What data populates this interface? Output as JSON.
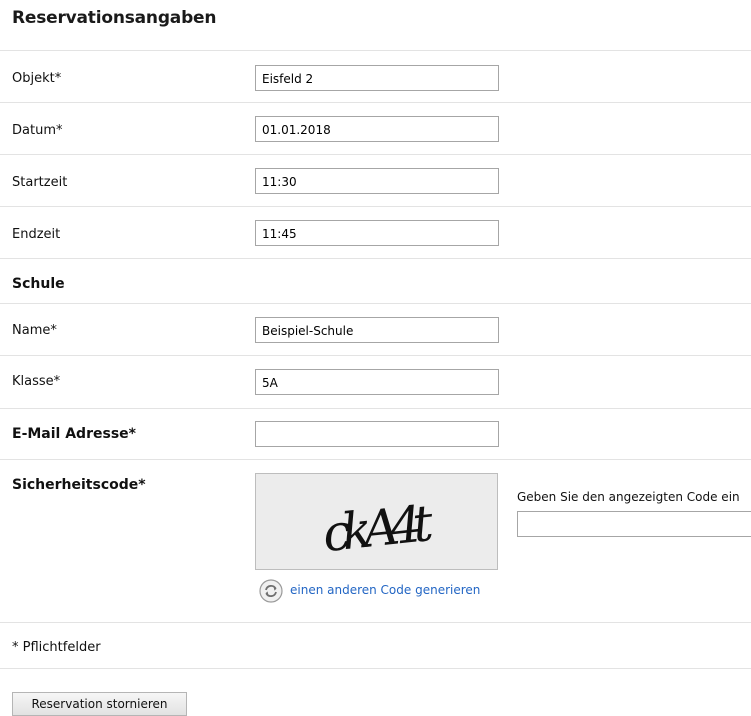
{
  "header": {
    "title": "Reservationsangaben"
  },
  "reservation": {
    "objekt_label": "Objekt*",
    "objekt_value": "Eisfeld 2",
    "datum_label": "Datum*",
    "datum_value": "01.01.2018",
    "startzeit_label": "Startzeit",
    "startzeit_value": "11:30",
    "endzeit_label": "Endzeit",
    "endzeit_value": "11:45"
  },
  "school": {
    "section_label": "Schule",
    "name_label": "Name*",
    "name_value": "Beispiel-Schule",
    "klasse_label": "Klasse*",
    "klasse_value": "5A"
  },
  "email": {
    "label": "E-Mail Adresse*",
    "value": ""
  },
  "security": {
    "label": "Sicherheitscode*",
    "captcha_text": "ckA4t",
    "refresh_icon": "refresh-icon",
    "refresh_link": "einen anderen Code generieren",
    "code_hint": "Geben Sie den angezeigten Code ein",
    "code_value": ""
  },
  "footer": {
    "required_note": "* Pflichtfelder",
    "cancel_button": "Reservation stornieren"
  },
  "colors": {
    "link": "#2366c4",
    "rule": "#e3e3e3",
    "field_border": "#a6a6a6"
  }
}
